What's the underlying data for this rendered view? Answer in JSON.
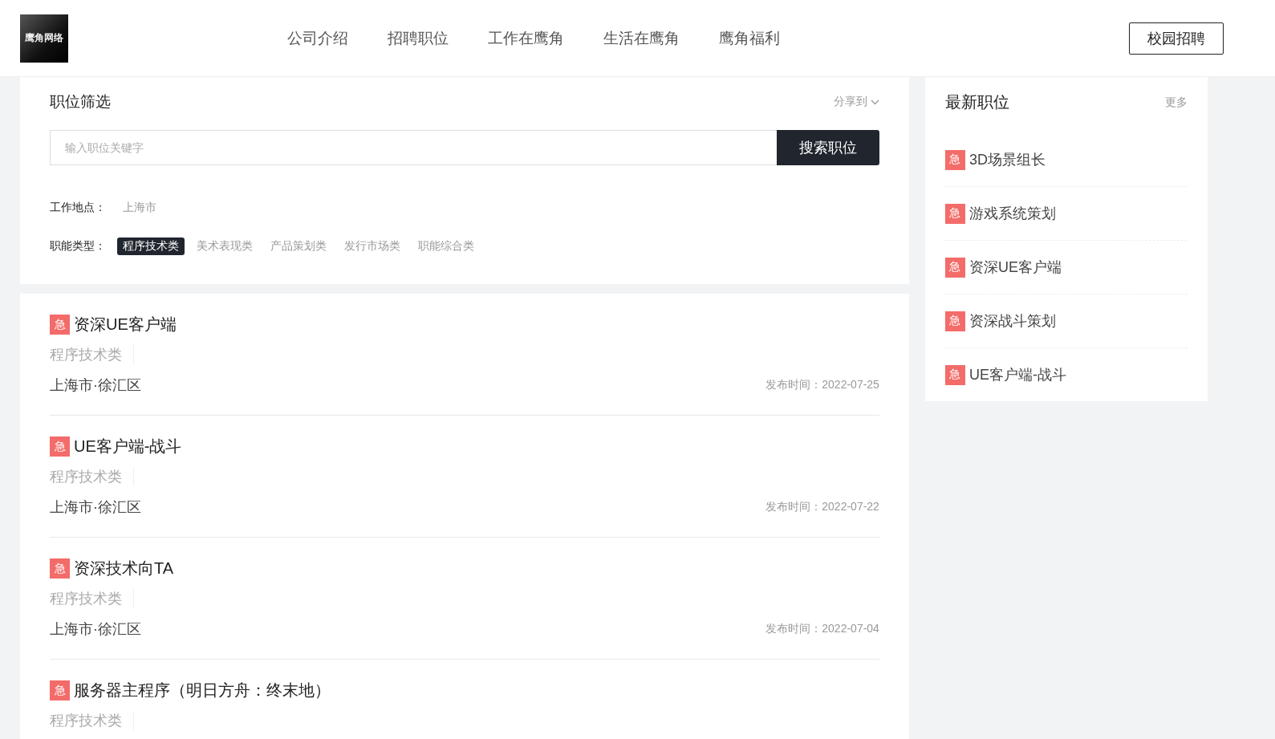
{
  "header": {
    "logo_text": "鹰角网络",
    "nav": [
      {
        "label": "公司介绍",
        "selected": false
      },
      {
        "label": "招聘职位",
        "selected": false
      },
      {
        "label": "工作在鹰角",
        "selected": false
      },
      {
        "label": "生活在鹰角",
        "selected": false
      },
      {
        "label": "鹰角福利",
        "selected": false
      }
    ],
    "campus_button": "校园招聘"
  },
  "filter": {
    "title": "职位筛选",
    "share": "分享到",
    "search": {
      "placeholder": "输入职位关键字",
      "button": "搜索职位"
    },
    "location": {
      "label": "工作地点：",
      "options": [
        {
          "label": "上海市",
          "selected": false
        }
      ]
    },
    "category": {
      "label": "职能类型：",
      "options": [
        {
          "label": "程序技术类",
          "selected": true
        },
        {
          "label": "美术表现类",
          "selected": false
        },
        {
          "label": "产品策划类",
          "selected": false
        },
        {
          "label": "发行市场类",
          "selected": false
        },
        {
          "label": "职能综合类",
          "selected": false
        }
      ]
    }
  },
  "jobs": [
    {
      "badge": "急",
      "title": "资深UE客户端",
      "category": "程序技术类",
      "location": "上海市·徐汇区",
      "date": "发布时间：2022-07-25"
    },
    {
      "badge": "急",
      "title": "UE客户端-战斗",
      "category": "程序技术类",
      "location": "上海市·徐汇区",
      "date": "发布时间：2022-07-22"
    },
    {
      "badge": "急",
      "title": "资深技术向TA",
      "category": "程序技术类",
      "location": "上海市·徐汇区",
      "date": "发布时间：2022-07-04"
    },
    {
      "badge": "急",
      "title": "服务器主程序（明日方舟：终末地）",
      "category": "程序技术类"
    }
  ],
  "latest": {
    "title": "最新职位",
    "more": "更多",
    "items": [
      {
        "badge": "急",
        "title": "3D场景组长"
      },
      {
        "badge": "急",
        "title": "游戏系统策划"
      },
      {
        "badge": "急",
        "title": "资深UE客户端"
      },
      {
        "badge": "急",
        "title": "资深战斗策划"
      },
      {
        "badge": "急",
        "title": "UE客户端-战斗"
      }
    ]
  }
}
